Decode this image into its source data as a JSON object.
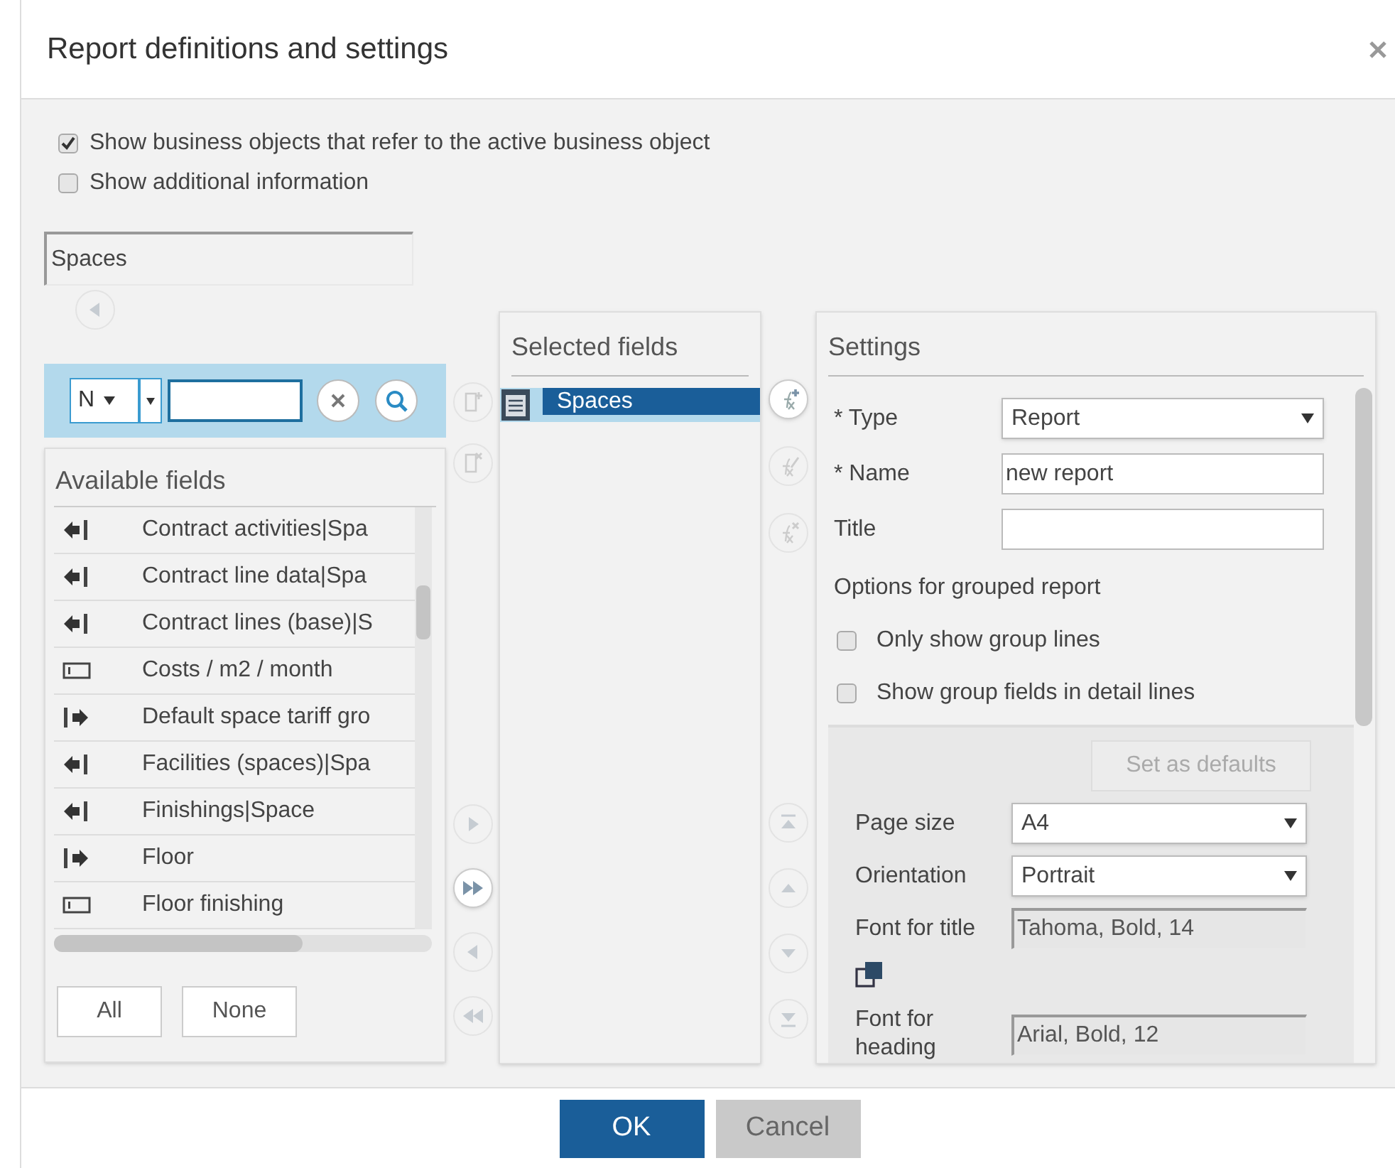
{
  "dialog": {
    "title": "Report definitions and settings"
  },
  "options": [
    {
      "label": "Show business objects that refer to the active business object",
      "checked": true
    },
    {
      "label": "Show additional information",
      "checked": false
    }
  ],
  "object_field": {
    "value": "Spaces"
  },
  "search": {
    "mode": "N"
  },
  "available_fields": {
    "title": "Available fields",
    "items": [
      {
        "label": "Contract activities|Spa",
        "kind": "back"
      },
      {
        "label": "Contract line data|Spa",
        "kind": "back"
      },
      {
        "label": "Contract lines (base)|S",
        "kind": "back"
      },
      {
        "label": "Costs / m2 / month",
        "kind": "field"
      },
      {
        "label": "Default space tariff gro",
        "kind": "forward"
      },
      {
        "label": "Facilities (spaces)|Spa",
        "kind": "back"
      },
      {
        "label": "Finishings|Space",
        "kind": "back"
      },
      {
        "label": "Floor",
        "kind": "forward"
      },
      {
        "label": "Floor finishing",
        "kind": "field"
      }
    ],
    "buttons": [
      "All",
      "None"
    ]
  },
  "transfer_tools": [
    {
      "kind": "add-doc",
      "disabled": true
    },
    {
      "kind": "remove-doc",
      "disabled": true
    },
    {
      "kind": "move-right",
      "disabled": true
    },
    {
      "kind": "move-all-right",
      "disabled": false
    },
    {
      "kind": "move-left",
      "disabled": true
    },
    {
      "kind": "move-all-left",
      "disabled": true
    }
  ],
  "selected_fields": {
    "title": "Selected fields",
    "items": [
      {
        "label": "Spaces",
        "selected": true
      }
    ]
  },
  "formula_tools": [
    {
      "kind": "fx-add",
      "disabled": false
    },
    {
      "kind": "fx-edit",
      "disabled": true
    },
    {
      "kind": "fx-remove",
      "disabled": true
    },
    {
      "kind": "top",
      "disabled": true
    },
    {
      "kind": "up",
      "disabled": true
    },
    {
      "kind": "down",
      "disabled": true
    },
    {
      "kind": "bottom",
      "disabled": true
    }
  ],
  "settings": {
    "title": "Settings",
    "fields": [
      {
        "kind": "select",
        "label": "* Type",
        "value": "Report"
      },
      {
        "kind": "text",
        "label": "* Name",
        "value": "new report"
      },
      {
        "kind": "text",
        "label": "Title"
      }
    ],
    "group_label": "Options for grouped report",
    "group_options": [
      {
        "label": "Only show group lines",
        "checked": false
      },
      {
        "label": "Show group fields in detail lines",
        "checked": false
      }
    ],
    "defaults_button": {
      "label": "Set as defaults",
      "disabled": true
    },
    "layout_fields": [
      {
        "kind": "select",
        "label": "Page size",
        "value": "A4"
      },
      {
        "kind": "select",
        "label": "Orientation",
        "value": "Portrait"
      },
      {
        "kind": "readonly",
        "label": "Font for title",
        "value": "Tahoma, Bold, 14"
      },
      {
        "kind": "font-icon"
      },
      {
        "kind": "readonly",
        "label": "Font for heading",
        "value": "Arial, Bold, 12"
      }
    ]
  },
  "footer": [
    {
      "label": "OK",
      "kind": "primary"
    },
    {
      "label": "Cancel",
      "kind": "secondary"
    }
  ]
}
